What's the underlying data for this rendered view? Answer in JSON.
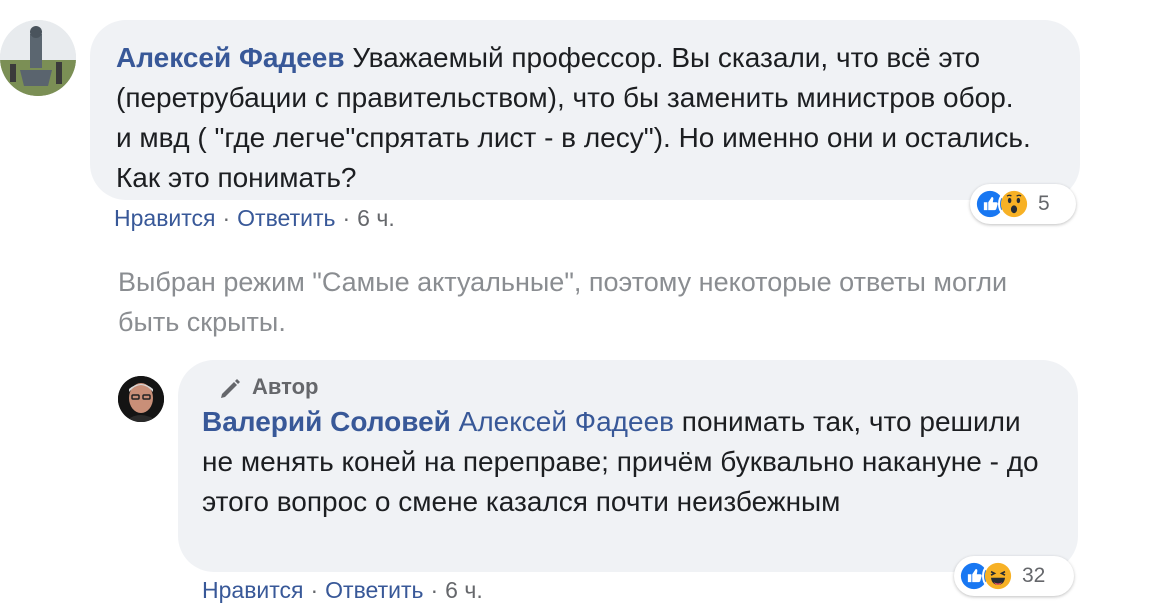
{
  "comment1": {
    "author": "Алексей Фадеев",
    "text": "Уважаемый профессор. Вы сказали, что всё это (перетрубации с правительством), что бы заменить министров обор. и мвд ( \"где легче\"спрятать лист - в лесу\"). Но именно они и остались. Как это понимать?",
    "like_label": "Нравится",
    "reply_label": "Ответить",
    "time": "6 ч.",
    "separator": "·",
    "reactions": {
      "icons": [
        "like-icon",
        "wow-icon"
      ],
      "count": "5"
    }
  },
  "info_text": "Выбран режим \"Самые актуальные\", поэтому некоторые ответы могли быть скрыты.",
  "reply1": {
    "badge_label": "Автор",
    "author": "Валерий Соловей",
    "mention": "Алексей Фадеев",
    "text": "понимать так, что решили не менять коней на переправе; причём буквально накануне - до этого вопрос о смене казался почти неизбежным",
    "like_label": "Нравится",
    "reply_label": "Ответить",
    "time": "6 ч.",
    "separator": "·",
    "reactions": {
      "icons": [
        "like-icon",
        "haha-icon"
      ],
      "count": "32"
    }
  },
  "colors": {
    "link": "#385898",
    "bubble": "#f0f2f5",
    "muted": "#65676b",
    "like_blue": "#1877f2",
    "emoji_yellow": "#f7b125"
  }
}
